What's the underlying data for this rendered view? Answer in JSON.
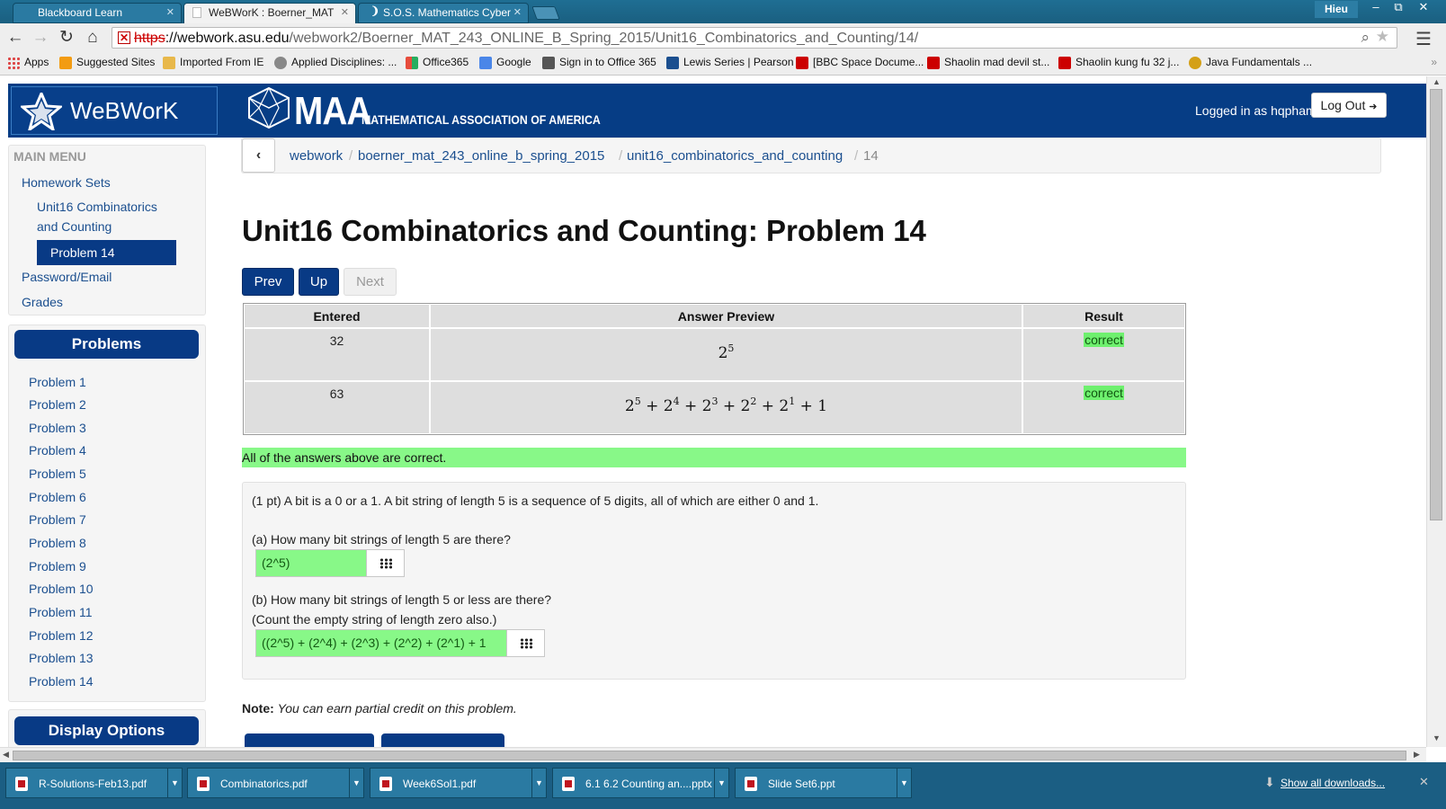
{
  "browser": {
    "tabs": [
      {
        "label": "Blackboard Learn"
      },
      {
        "label": "WeBWorK : Boerner_MAT"
      },
      {
        "label": "S.O.S. Mathematics Cyber"
      }
    ],
    "user": "Hieu",
    "url": {
      "scheme": "https",
      "domain": "://webwork.asu.edu",
      "path": "/webwork2/Boerner_MAT_243_ONLINE_B_Spring_2015/Unit16_Combinatorics_and_Counting/14/"
    },
    "bookmarks": [
      {
        "label": "Apps",
        "color": "#d44"
      },
      {
        "label": "Suggested Sites",
        "color": "#f39c12"
      },
      {
        "label": "Imported From IE",
        "color": "#e8b84a"
      },
      {
        "label": "Applied Disciplines: ...",
        "color": "#888"
      },
      {
        "label": "Office365",
        "color": "#e67e22"
      },
      {
        "label": "Google",
        "color": "#4a86e8"
      },
      {
        "label": "Sign in to Office 365",
        "color": "#555"
      },
      {
        "label": "Lewis Series | Pearson",
        "color": "#1b4f8f"
      },
      {
        "label": "[BBC Space Docume...",
        "color": "#cc0000"
      },
      {
        "label": "Shaolin mad devil st...",
        "color": "#cc0000"
      },
      {
        "label": "Shaolin kung fu 32 j...",
        "color": "#cc0000"
      },
      {
        "label": "Java Fundamentals ...",
        "color": "#d4a017"
      }
    ],
    "bookmarks_more": "»"
  },
  "header": {
    "logo_text": "WeBWorK",
    "maa_abbr": "MAA",
    "maa_name": "MATHEMATICAL ASSOCIATION OF AMERICA",
    "login_status": "Logged in as hqpham.",
    "logout_label": "Log Out"
  },
  "sidebar": {
    "main_menu_title": "MAIN MENU",
    "homework_sets": "Homework Sets",
    "current_set_line1": "Unit16 Combinatorics",
    "current_set_line2": "and Counting",
    "current_problem": "Problem 14",
    "password_email": "Password/Email",
    "grades": "Grades",
    "problems_title": "Problems",
    "problems": [
      "Problem 1",
      "Problem 2",
      "Problem 3",
      "Problem 4",
      "Problem 5",
      "Problem 6",
      "Problem 7",
      "Problem 8",
      "Problem 9",
      "Problem 10",
      "Problem 11",
      "Problem 12",
      "Problem 13",
      "Problem 14"
    ],
    "display_options_title": "Display Options"
  },
  "breadcrumb": {
    "items": [
      "webwork",
      "boerner_mat_243_online_b_spring_2015",
      "unit16_combinatorics_and_counting"
    ],
    "current": "14",
    "separator": "/"
  },
  "page_title": "Unit16 Combinatorics and Counting: Problem 14",
  "nav_buttons": {
    "prev": "Prev",
    "up": "Up",
    "next": "Next"
  },
  "results": {
    "headers": [
      "Entered",
      "Answer Preview",
      "Result"
    ],
    "rows": [
      {
        "entered": "32",
        "preview": "2^5",
        "result": "correct"
      },
      {
        "entered": "63",
        "preview": "2^5 + 2^4 + 2^3 + 2^2 + 2^1 + 1",
        "result": "correct"
      }
    ],
    "summary": "All of the answers above are correct."
  },
  "problem": {
    "intro": "(1 pt) A bit is a 0 or a 1. A bit string of length 5 is a sequence of 5 digits, all of which are either 0 and 1.",
    "part_a": "(a) How many bit strings of length 5 are there?",
    "answer_a": "(2^5)",
    "part_b": "(b) How many bit strings of length 5 or less are there?",
    "part_b_note": "(Count the empty string of length zero also.)",
    "answer_b": "((2^5) + (2^4) + (2^3) + (2^2) + (2^1) + 1"
  },
  "note": {
    "label": "Note:",
    "text": "You can earn partial credit on this problem."
  },
  "downloads": {
    "items": [
      "R-Solutions-Feb13.pdf",
      "Combinatorics.pdf",
      "Week6Sol1.pdf",
      "6.1 6.2 Counting an....pptx",
      "Slide Set6.ppt"
    ],
    "show_all": "Show all downloads..."
  }
}
